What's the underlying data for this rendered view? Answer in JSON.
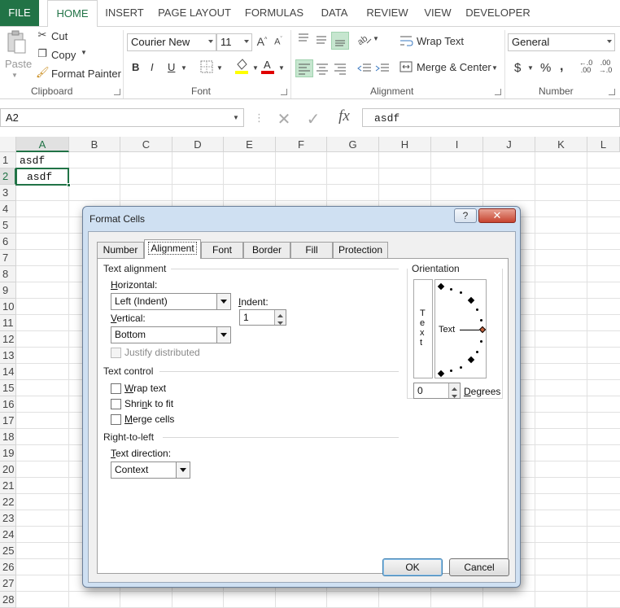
{
  "ribbon_tabs": [
    "FILE",
    "HOME",
    "INSERT",
    "PAGE LAYOUT",
    "FORMULAS",
    "DATA",
    "REVIEW",
    "VIEW",
    "DEVELOPER"
  ],
  "clipboard": {
    "paste": "Paste",
    "cut": "Cut",
    "copy": "Copy",
    "format_painter": "Format Painter",
    "label": "Clipboard"
  },
  "font": {
    "name": "Courier New",
    "size": "11",
    "bold": "B",
    "italic": "I",
    "underline": "U",
    "label": "Font"
  },
  "alignment": {
    "wrap_text": "Wrap Text",
    "merge_center": "Merge & Center",
    "label": "Alignment"
  },
  "number": {
    "format": "General",
    "currency": "$",
    "percent": "%",
    "comma": ",",
    "label": "Number"
  },
  "formula_bar": {
    "name_box": "A2",
    "fx": "fx",
    "value": "asdf"
  },
  "columns": [
    "A",
    "B",
    "C",
    "D",
    "E",
    "F",
    "G",
    "H",
    "I",
    "J",
    "K",
    "L"
  ],
  "rows": [
    "1",
    "2",
    "3",
    "4",
    "5",
    "6",
    "7",
    "8",
    "9",
    "10",
    "11",
    "12",
    "13",
    "14",
    "15",
    "16",
    "17",
    "18",
    "19",
    "20",
    "21",
    "22",
    "23",
    "24",
    "25",
    "26",
    "27",
    "28"
  ],
  "cells": {
    "a1": "asdf",
    "a2": "asdf"
  },
  "dialog": {
    "title": "Format Cells",
    "help": "?",
    "close": "✕",
    "tabs": [
      "Number",
      "Alignment",
      "Font",
      "Border",
      "Fill",
      "Protection"
    ],
    "text_alignment": "Text alignment",
    "horizontal_label": "Horizontal:",
    "horizontal_value": "Left (Indent)",
    "indent_label": "Indent:",
    "indent_value": "1",
    "vertical_label": "Vertical:",
    "vertical_value": "Bottom",
    "justify_distributed": "Justify distributed",
    "text_control": "Text control",
    "wrap_text": "Wrap text",
    "shrink_to_fit": "Shrink to fit",
    "merge_cells": "Merge cells",
    "right_to_left": "Right-to-left",
    "text_direction_label": "Text direction:",
    "text_direction_value": "Context",
    "orientation": "Orientation",
    "orientation_vertical_text": [
      "T",
      "e",
      "x",
      "t"
    ],
    "orientation_text": "Text",
    "degrees_value": "0",
    "degrees_label": "Degrees",
    "ok": "OK",
    "cancel": "Cancel"
  },
  "colors": {
    "excel_green": "#217346",
    "selected_cell_border": "#217346",
    "dialog_frame": "#cfe0f2"
  }
}
